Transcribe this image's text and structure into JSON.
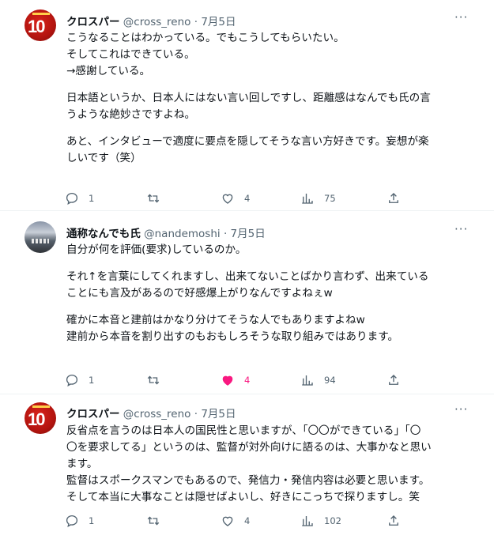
{
  "tweets": [
    {
      "name": "クロスパー",
      "handle": "@cross_reno",
      "sep": "·",
      "date": "7月5日",
      "more": "···",
      "avatar": "cross-reno-avatar",
      "lines": [
        "こうなることはわかっている。でもこうしてもらいたい。",
        "そしてこれはできている。",
        "→感謝している。",
        "",
        "日本語というか、日本人にはない言い回しですし、距離感はなんでも氏の言",
        "うような絶妙さですよね。",
        "",
        "あと、インタビューで適度に要点を隠してそうな言い方好きです。妄想が楽",
        "しいです（笑）"
      ],
      "replies": "1",
      "retweets": "",
      "likes": "4",
      "views": "75",
      "liked": false
    },
    {
      "name": "通称なんでも氏",
      "handle": "@nandemoshi",
      "sep": "·",
      "date": "7月5日",
      "more": "···",
      "avatar": "nandemoshi-avatar",
      "lines": [
        "自分が何を評価(要求)しているのか。",
        "",
        "それ↑を言葉にしてくれますし、出来てないことばかり言わず、出来ている",
        "ことにも言及があるので好感爆上がりなんですよねぇw",
        "",
        "確かに本音と建前はかなり分けてそうな人でもありますよねw",
        "建前から本音を割り出すのもおもしろそうな取り組みではあります。"
      ],
      "replies": "1",
      "retweets": "",
      "likes": "4",
      "views": "94",
      "liked": true
    },
    {
      "name": "クロスパー",
      "handle": "@cross_reno",
      "sep": "·",
      "date": "7月5日",
      "more": "···",
      "avatar": "cross-reno-avatar",
      "lines": [
        "反省点を言うのは日本人の国民性と思いますが、「〇〇ができている」「〇",
        "〇を要求してる」というのは、監督が対外向けに語るのは、大事かなと思い",
        "ます。",
        "監督はスポークスマンでもあるので、発信力・発信内容は必要と思います。",
        "そして本当に大事なことは隠せばよいし、好きにこっちで探りますし。笑"
      ],
      "replies": "1",
      "retweets": "",
      "likes": "4",
      "views": "102",
      "liked": false
    }
  ],
  "colors": {
    "text": "#0f1419",
    "muted": "#536471",
    "like_active": "#f91880",
    "divider": "#eff3f4"
  },
  "icons": [
    "reply-icon",
    "retweet-icon",
    "like-icon",
    "views-icon",
    "share-icon",
    "more-icon"
  ]
}
